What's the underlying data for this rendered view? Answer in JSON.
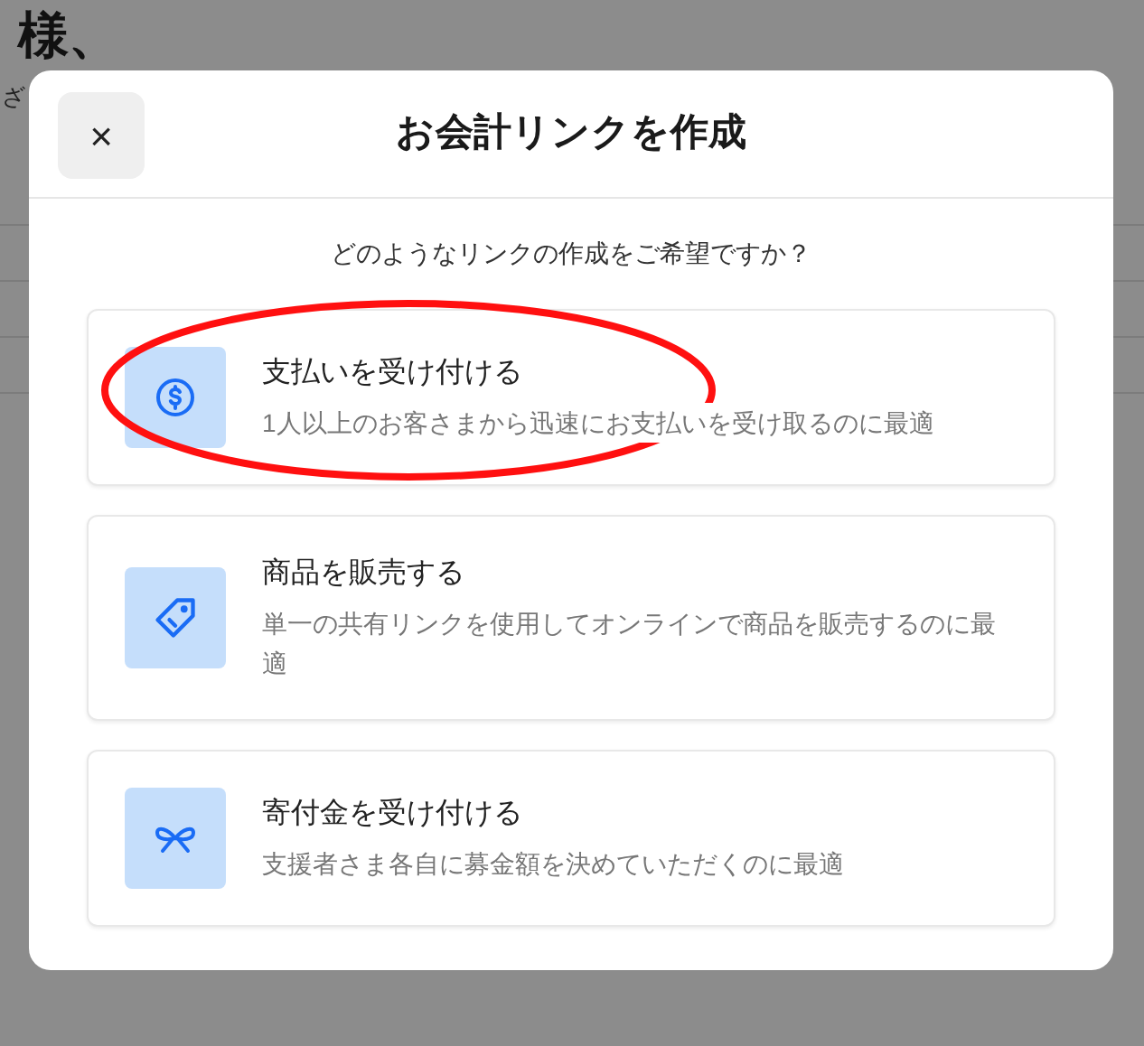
{
  "background": {
    "heading": "様、",
    "subtext": "ざ"
  },
  "dialog": {
    "title": "お会計リンクを作成",
    "close_label": "×",
    "question": "どのようなリンクの作成をご希望ですか？",
    "options": [
      {
        "kind": "dollar",
        "title": "支払いを受け付ける",
        "description": "1人以上のお客さまから迅速にお支払いを受け取るのに最適"
      },
      {
        "kind": "tag",
        "title": "商品を販売する",
        "description": "単一の共有リンクを使用してオンラインで商品を販売するのに最適"
      },
      {
        "kind": "bow",
        "title": "寄付金を受け付ける",
        "description": "支援者さま各自に募金額を決めていただくのに最適"
      }
    ]
  }
}
